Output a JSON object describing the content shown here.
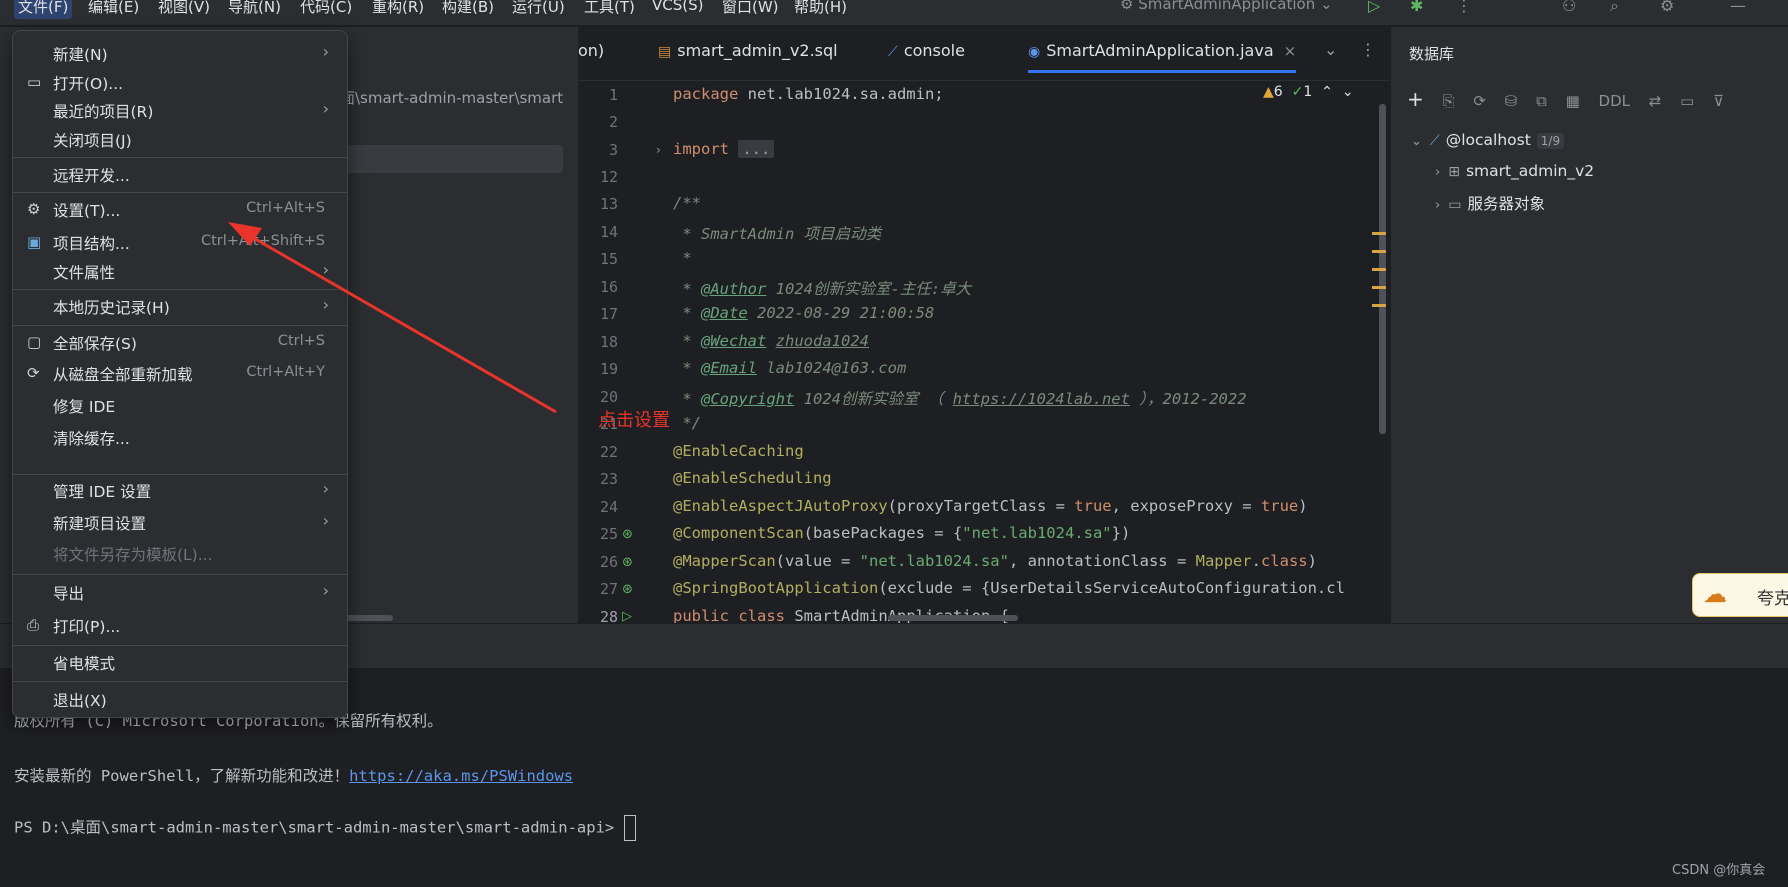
{
  "menubar": {
    "items": [
      "文件(F)",
      "编辑(E)",
      "视图(V)",
      "导航(N)",
      "代码(C)",
      "重构(R)",
      "构建(B)",
      "运行(U)",
      "工具(T)",
      "VCS(S)",
      "窗口(W)",
      "帮助(H)"
    ],
    "run_config": "SmartAdminApplication",
    "icons": [
      "run-icon",
      "debug-icon",
      "more-icon",
      "add-user-icon",
      "search-icon",
      "settings-icon",
      "minimize-icon"
    ]
  },
  "project": {
    "path": "面\\smart-admin-master\\smart"
  },
  "tabs": [
    {
      "label": "on)"
    },
    {
      "label": "smart_admin_v2.sql"
    },
    {
      "label": "console"
    },
    {
      "label": "SmartAdminApplication.java",
      "close": "×"
    }
  ],
  "editor": {
    "line_numbers": [
      "1",
      "2",
      "3",
      "12",
      "13",
      "14",
      "15",
      "16",
      "17",
      "18",
      "19",
      "20",
      "21",
      "22",
      "23",
      "24",
      "25",
      "26",
      "27",
      "28"
    ],
    "inspection": {
      "warnings": "6",
      "ok": "1"
    },
    "lines": {
      "l1_kw": "package",
      "l1_rest": " net.lab1024.sa.admin;",
      "l3_kw": "import",
      "l3_fold": "...",
      "l13": "/**",
      "l14": " * SmartAdmin 项目启动类",
      "l15": " *",
      "l16_a": " * ",
      "l16_tag": "@Author",
      "l16_b": " 1024创新实验室-主任:卓大",
      "l17_a": " * ",
      "l17_tag": "@Date",
      "l17_b": " 2022-08-29 21:00:58",
      "l18_a": " * ",
      "l18_tag": "@Wechat",
      "l18_b": " ",
      "l18_link": "zhuoda1024",
      "l19_a": " * ",
      "l19_tag": "@Email",
      "l19_b": " lab1024@163.com",
      "l20_a": " * ",
      "l20_tag": "@Copyright",
      "l20_b": " 1024创新实验室 （ ",
      "l20_link": "https://1024lab.net",
      "l20_c": " ），2012-2022",
      "l21": " */",
      "l22": "@EnableCaching",
      "l23": "@EnableScheduling",
      "l24_an": "@EnableAspectJAutoProxy",
      "l24_a": "(proxyTargetClass = ",
      "l24_t1": "true",
      "l24_b": ", exposeProxy = ",
      "l24_t2": "true",
      "l24_c": ")",
      "l25_an": "@ComponentScan",
      "l25_a": "(basePackages = {",
      "l25_s": "\"net.lab1024.sa\"",
      "l25_b": "})",
      "l26_an": "@MapperScan",
      "l26_a": "(value = ",
      "l26_s": "\"net.lab1024.sa\"",
      "l26_b": ", annotationClass = ",
      "l26_cls": "Mapper",
      "l26_c": ".",
      "l26_kw": "class",
      "l26_d": ")",
      "l27_an": "@SpringBootApplication",
      "l27_a": "(exclude = {UserDetailsServiceAutoConfiguration.cl",
      "l28_kw1": "public",
      "l28_kw2": "class",
      "l28_rest": " SmartAdminApplication {"
    }
  },
  "database": {
    "title": "数据库",
    "toolbar": [
      "+",
      "⎘",
      "⟳",
      "⛁",
      "⧉",
      "▦",
      "DDL",
      "⇄",
      "▭",
      "⊽"
    ],
    "tree": [
      {
        "label": "@localhost",
        "badge": "1/9"
      },
      {
        "label": "smart_admin_v2"
      },
      {
        "label": "服务器对象"
      }
    ]
  },
  "widget": {
    "label": "夸克"
  },
  "terminal": {
    "line1": "版权所有 (C) Microsoft Corporation。保留所有权利。",
    "line2_text": "安装最新的 PowerShell，了解新功能和改进！",
    "line2_link": "https://aka.ms/PSWindows",
    "prompt": "PS D:\\桌面\\smart-admin-master\\smart-admin-master\\smart-admin-api> "
  },
  "watermark": "CSDN @你真会",
  "file_menu": {
    "items": [
      {
        "label": "新建(N)",
        "submenu": true
      },
      {
        "label": "打开(O)...",
        "icon": "folder-icon"
      },
      {
        "label": "最近的项目(R)",
        "submenu": true
      },
      {
        "label": "关闭项目(J)"
      },
      {
        "label": "远程开发..."
      },
      {
        "label": "设置(T)...",
        "icon": "gear-icon",
        "shortcut": "Ctrl+Alt+S"
      },
      {
        "label": "项目结构...",
        "icon": "project-structure-icon",
        "shortcut": "Ctrl+Alt+Shift+S"
      },
      {
        "label": "文件属性",
        "submenu": true
      },
      {
        "label": "本地历史记录(H)",
        "submenu": true
      },
      {
        "label": "全部保存(S)",
        "icon": "save-icon",
        "shortcut": "Ctrl+S"
      },
      {
        "label": "从磁盘全部重新加载",
        "icon": "reload-icon",
        "shortcut": "Ctrl+Alt+Y"
      },
      {
        "label": "修复 IDE"
      },
      {
        "label": "清除缓存..."
      },
      {
        "label": "管理 IDE 设置",
        "submenu": true
      },
      {
        "label": "新建项目设置",
        "submenu": true
      },
      {
        "label": "将文件另存为模板(L)...",
        "disabled": true
      },
      {
        "label": "导出",
        "submenu": true
      },
      {
        "label": "打印(P)...",
        "icon": "print-icon"
      },
      {
        "label": "省电模式"
      },
      {
        "label": "退出(X)"
      }
    ]
  },
  "annotation": {
    "text": "点击设置",
    "color": "#e8342b"
  }
}
